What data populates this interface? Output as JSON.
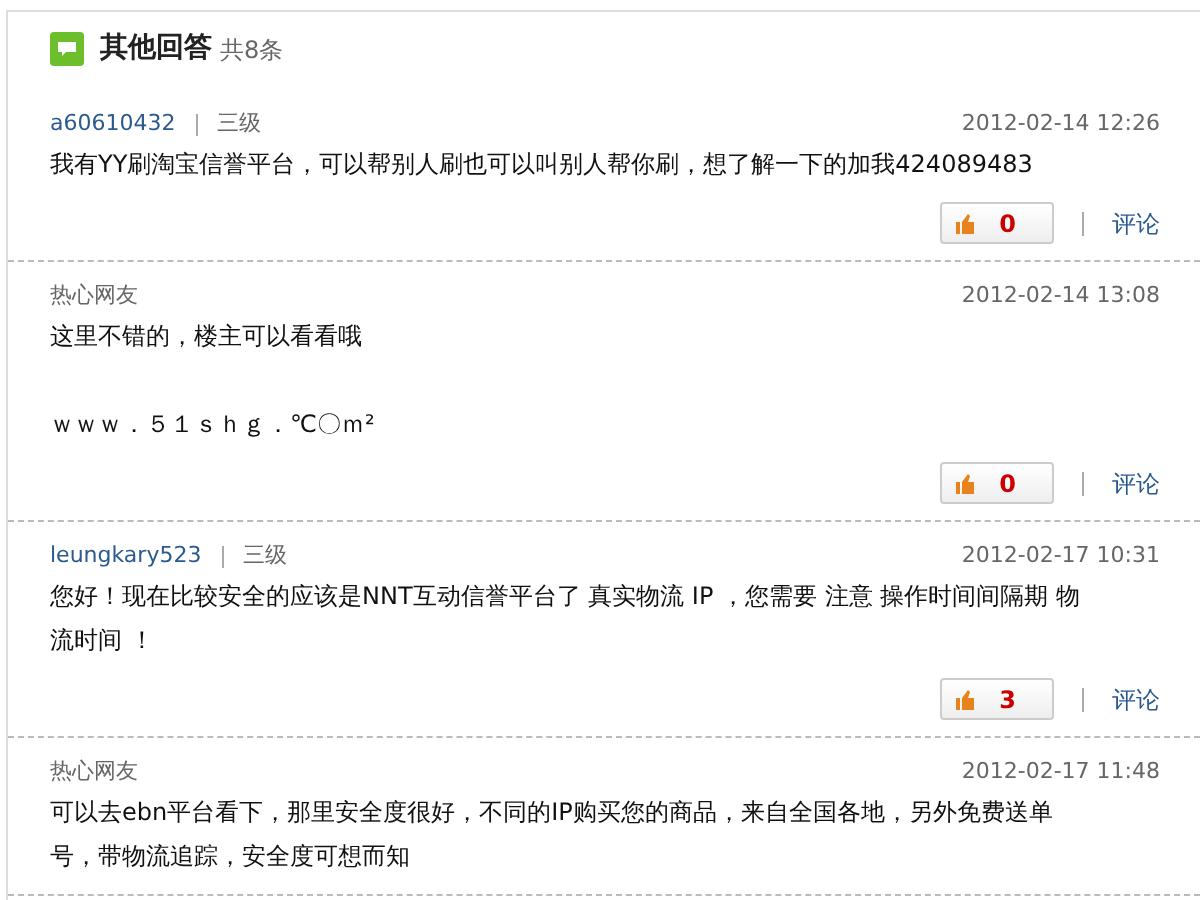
{
  "header": {
    "title": "其他回答",
    "count": "共8条"
  },
  "answers": [
    {
      "author": "a60610432",
      "linked": true,
      "level": "三级",
      "time": "2012-02-14 12:26",
      "paragraphs": [
        "我有YY刷淘宝信誉平台，可以帮别人刷也可以叫别人帮你刷，想了解一下的加我424089483"
      ],
      "likes": "0",
      "comment": "评论"
    },
    {
      "author": "热心网友",
      "linked": false,
      "time": "2012-02-14 13:08",
      "paragraphs": [
        "这里不错的，楼主可以看看哦",
        "ｗｗｗ．５１ｓｈｇ．℃〇ｍ²"
      ],
      "likes": "0",
      "comment": "评论"
    },
    {
      "author": "leungkary523",
      "linked": true,
      "level": "三级",
      "time": "2012-02-17 10:31",
      "paragraphs": [
        "您好！现在比较安全的应该是NNT互动信誉平台了 真实物流 IP ，您需要 注意 操作时间间隔期 物流时间 ！"
      ],
      "likes": "3",
      "comment": "评论"
    },
    {
      "author": "热心网友",
      "linked": false,
      "time": "2012-02-17 11:48",
      "paragraphs": [
        "可以去ebn平台看下，那里安全度很好，不同的IP购买您的商品，来自全国各地，另外免费送单号，带物流追踪，安全度可想而知"
      ]
    }
  ]
}
